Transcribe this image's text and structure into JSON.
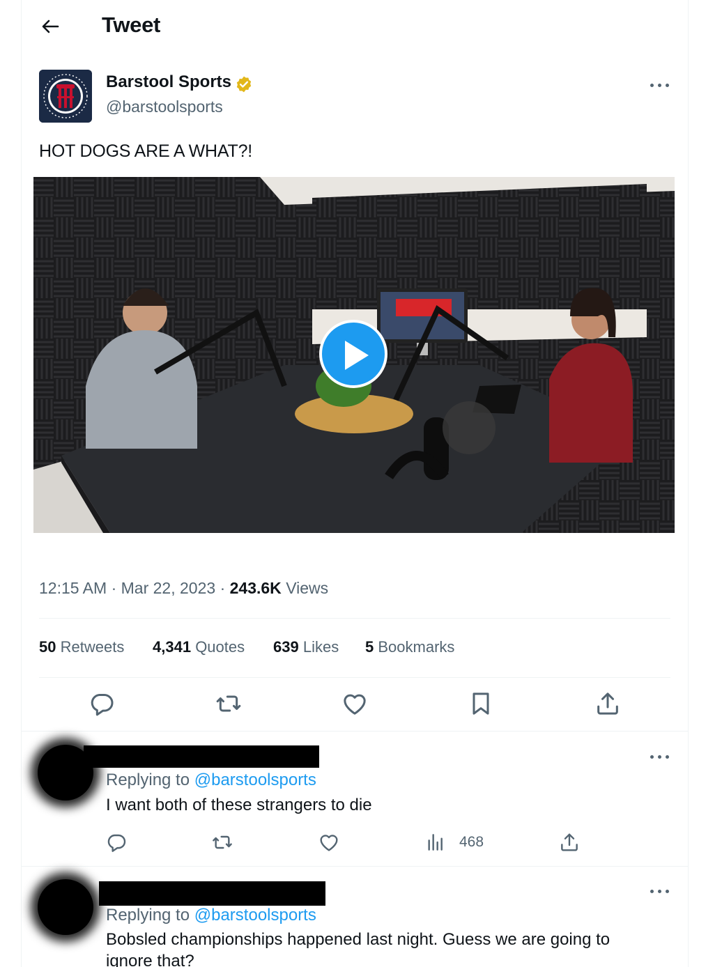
{
  "header": {
    "title": "Tweet"
  },
  "tweet": {
    "author_name": "Barstool Sports",
    "author_handle": "@barstoolsports",
    "text": "HOT DOGS ARE A WHAT?!",
    "time": "12:15 AM",
    "date": "Mar 22, 2023",
    "views_count": "243.6K",
    "views_label": "Views",
    "stats": [
      {
        "count": "50",
        "label": "Retweets"
      },
      {
        "count": "4,341",
        "label": "Quotes"
      },
      {
        "count": "639",
        "label": "Likes"
      },
      {
        "count": "5",
        "label": "Bookmarks"
      }
    ]
  },
  "replies": [
    {
      "replying_prefix": "Replying to",
      "replying_handle": "@barstoolsports",
      "text": "I want both of these strangers to die",
      "views": "468"
    },
    {
      "replying_prefix": "Replying to",
      "replying_handle": "@barstoolsports",
      "text": "Bobsled championships happened last night. Guess we are going to ignore that?"
    }
  ],
  "colors": {
    "accent": "#1d9bf0",
    "secondary_text": "#536471",
    "verified_badge": "#e2b719"
  },
  "icons": [
    "back-arrow-icon",
    "verified-badge-icon",
    "more-options-icon",
    "play-icon",
    "reply-icon",
    "retweet-icon",
    "like-icon",
    "bookmark-icon",
    "share-icon",
    "views-icon"
  ]
}
